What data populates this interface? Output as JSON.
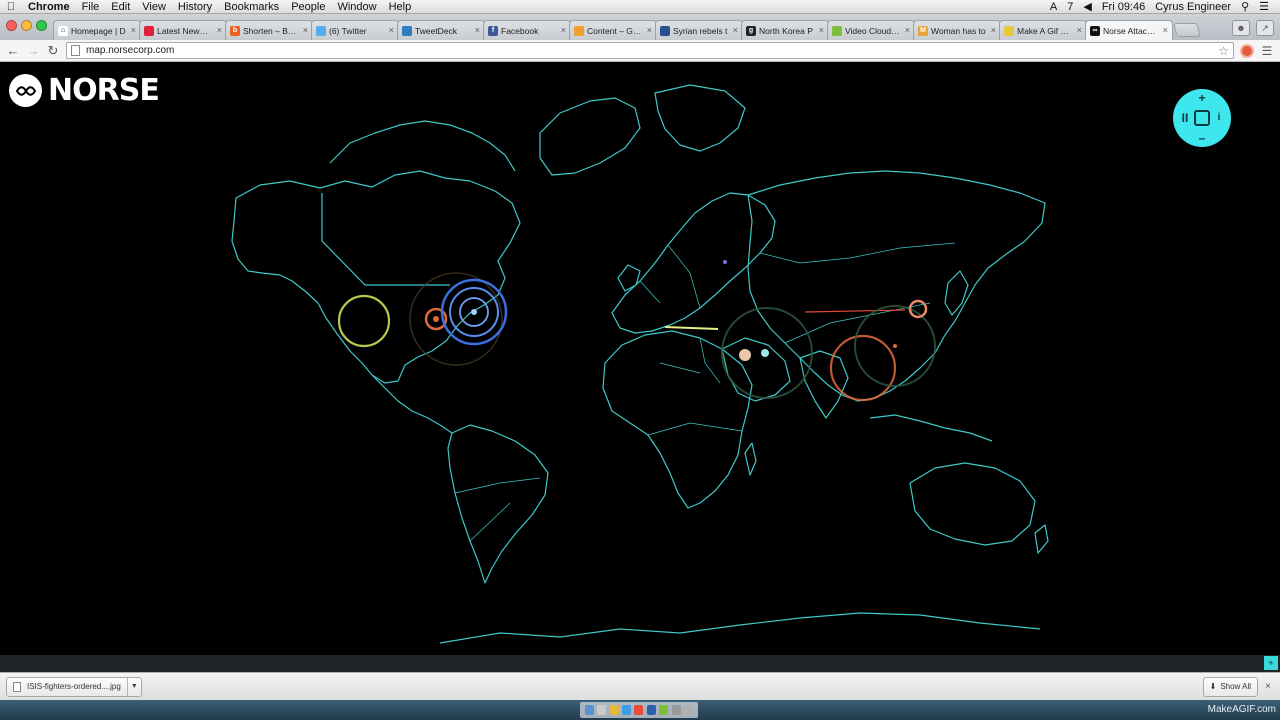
{
  "menubar": {
    "app_name": "Chrome",
    "menus": [
      "File",
      "Edit",
      "View",
      "History",
      "Bookmarks",
      "People",
      "Window",
      "Help"
    ],
    "status_notification_count": "7",
    "clock": "Fri 09:46",
    "user": "Cyrus Engineer"
  },
  "tabs": [
    {
      "title": "Homepage | D",
      "favicon_color": "#ffffff",
      "favicon_glyph": "⌂"
    },
    {
      "title": "Latest News | L",
      "favicon_color": "#e0203a",
      "favicon_glyph": ""
    },
    {
      "title": "Shorten – Bitly",
      "favicon_color": "#ee6123",
      "favicon_glyph": "b"
    },
    {
      "title": "(6) Twitter",
      "favicon_color": "#55acee",
      "favicon_glyph": ""
    },
    {
      "title": "TweetDeck",
      "favicon_color": "#2d7fbf",
      "favicon_glyph": ""
    },
    {
      "title": "Facebook",
      "favicon_color": "#3b5998",
      "favicon_glyph": "f"
    },
    {
      "title": "Content – Goo",
      "favicon_color": "#f2a02b",
      "favicon_glyph": ""
    },
    {
      "title": "Syrian rebels t",
      "favicon_color": "#2a4f8f",
      "favicon_glyph": ""
    },
    {
      "title": "North Korea P",
      "favicon_color": "#222222",
      "favicon_glyph": "g"
    },
    {
      "title": "Video Cloud St",
      "favicon_color": "#7bbf3a",
      "favicon_glyph": ""
    },
    {
      "title": "Woman has to",
      "favicon_color": "#e9a53a",
      "favicon_glyph": "M"
    },
    {
      "title": "Make A Gif – A",
      "favicon_color": "#e8c73c",
      "favicon_glyph": ""
    },
    {
      "title": "Norse Attack M",
      "favicon_color": "#111111",
      "favicon_glyph": "∞",
      "active": true
    }
  ],
  "toolbar": {
    "url": "map.norsecorp.com"
  },
  "page": {
    "logo_text": "NORSE",
    "controls": {
      "up": "+",
      "down": "–",
      "left": "II",
      "right": "i"
    }
  },
  "download_shelf": {
    "filename": "ISIS-fighters-ordered....jpg",
    "show_all": "Show All"
  },
  "watermark": "MakeAGIF.com",
  "colors": {
    "map_outline": "#3fc8c8",
    "accent_cyan": "#3ee6ee",
    "attack_yellow": "#b8c84a",
    "attack_orange": "#e06a3e",
    "attack_blue": "#3b6ee0"
  }
}
